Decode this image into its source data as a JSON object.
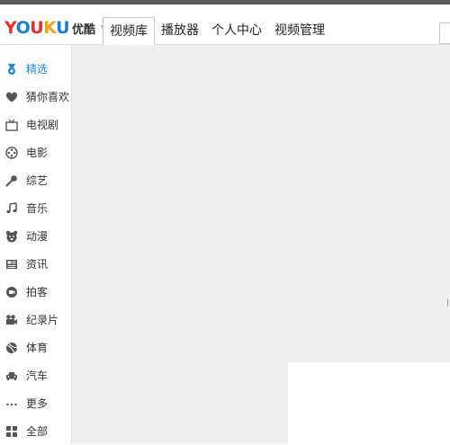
{
  "header": {
    "logo": {
      "brand": "YOUKU",
      "cn": "优酷"
    },
    "nav": [
      {
        "label": "视频库",
        "active": true
      },
      {
        "label": "播放器",
        "active": false
      },
      {
        "label": "个人中心",
        "active": false
      },
      {
        "label": "视频管理",
        "active": false
      }
    ]
  },
  "sidebar": {
    "items": [
      {
        "label": "精选",
        "icon": "medal-icon",
        "active": true
      },
      {
        "label": "猜你喜欢",
        "icon": "heart-icon",
        "active": false
      },
      {
        "label": "电视剧",
        "icon": "tv-icon",
        "active": false
      },
      {
        "label": "电影",
        "icon": "film-reel-icon",
        "active": false
      },
      {
        "label": "综艺",
        "icon": "microphone-icon",
        "active": false
      },
      {
        "label": "音乐",
        "icon": "music-note-icon",
        "active": false
      },
      {
        "label": "动漫",
        "icon": "bear-face-icon",
        "active": false
      },
      {
        "label": "资讯",
        "icon": "newspaper-icon",
        "active": false
      },
      {
        "label": "拍客",
        "icon": "camera-record-icon",
        "active": false
      },
      {
        "label": "纪录片",
        "icon": "video-camera-icon",
        "active": false
      },
      {
        "label": "体育",
        "icon": "ball-icon",
        "active": false
      },
      {
        "label": "汽车",
        "icon": "car-icon",
        "active": false
      },
      {
        "label": "更多",
        "icon": "ellipsis-icon",
        "active": false
      },
      {
        "label": "全部",
        "icon": "grid-icon",
        "active": false
      }
    ]
  },
  "colors": {
    "accent": "#1e8ad6",
    "icon": "#555555",
    "content_bg": "#efefef"
  }
}
